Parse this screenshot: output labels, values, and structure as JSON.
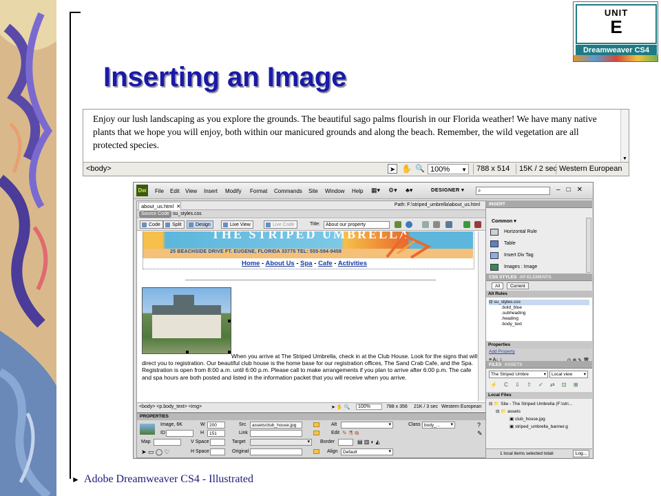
{
  "slide": {
    "title": "Inserting an Image",
    "footer": "Adobe Dreamweaver CS4 - Illustrated",
    "unit_word": "UNIT",
    "unit_letter": "E",
    "unit_product": "Dreamweaver CS4"
  },
  "snippet": {
    "paragraph": "Enjoy our lush landscaping as you explore the grounds. The beautiful sago palms flourish in our Florida weather! We have many native plants that we hope you will enjoy, both within our manicured grounds and along the beach. Remember, the wild vegetation are all protected species.",
    "tag": "<body>",
    "zoom": "100%",
    "dimensions": "788 x 514",
    "download": "15K / 2 sec",
    "encoding": "Western European"
  },
  "dw": {
    "logo": "Dw",
    "menus": [
      "File",
      "Edit",
      "View",
      "Insert",
      "Modify",
      "Format",
      "Commands",
      "Site",
      "Window",
      "Help"
    ],
    "workspace": "DESIGNER",
    "file_tab": "about_us.html",
    "path": "Path: F:\\striped_umbrella\\about_us.html",
    "source_code": "Source Code",
    "css_file": "su_styles.css",
    "btn_code": "Code",
    "btn_split": "Split",
    "btn_design": "Design",
    "btn_liveview": "Live View",
    "btn_livecode": "Live Code",
    "title_label": "Title:",
    "title_value": "About our property",
    "banner_title": "THE STRIPED UMBRELLA",
    "banner_address": "25 BEACHSIDE DRIVE   FT. EUGENE, FLORIDA 33775   TEL: 555-594-9458",
    "nav": {
      "home": "Home",
      "about": "About Us",
      "spa": "Spa",
      "cafe": "Cafe",
      "activities": "Activities",
      "sep": " - "
    },
    "body_text": "When you arrive at The Striped Umbrella, check in at the Club House. Look for the signs that will direct you to registration. Our beautiful club house is the home base for our registration offices, The Sand Crab Cafe, and the Spa. Registration is open from 8:00 a.m. until 6:00 p.m. Please call to make arrangements if you plan to arrive after 6:00 p.m. The cafe and spa hours are both posted and listed in the information packet that you will receive when you arrive.",
    "status": {
      "tags": "<body> <p.body_text> <img>",
      "zoom": "100%",
      "dims": "788 x 356",
      "download": "21K / 3 sec",
      "encoding": "Western European"
    }
  },
  "props": {
    "header": "PROPERTIES",
    "image_label": "Image, 6K",
    "w_label": "W",
    "w_value": "200",
    "h_label": "H",
    "h_value": "151",
    "id_label": "ID",
    "src_label": "Src",
    "src_value": "assets/club_house.jpg",
    "link_label": "Link",
    "alt_label": "Alt",
    "edit_label": "Edit",
    "class_label": "Class",
    "class_value": "body_...",
    "map_label": "Map",
    "vspace_label": "V Space",
    "hspace_label": "H Space",
    "target_label": "Target",
    "original_label": "Original",
    "border_label": "Border",
    "align_label": "Align",
    "align_value": "Default"
  },
  "panels": {
    "insert_header": "INSERT",
    "insert_category": "Common",
    "insert_items": [
      "Horizontal Rule",
      "Table",
      "Insert Div Tag",
      "Images : Image"
    ],
    "css_header": "CSS STYLES",
    "ap_header": "AP ELEMENTS",
    "btn_all": "All",
    "btn_current": "Current",
    "all_rules": "All Rules",
    "css_tree": [
      "su_styles.css",
      ".bold_blue",
      ".subheading",
      ".heading",
      ".body_text"
    ],
    "properties_label": "Properties",
    "add_property": "Add Property",
    "files_header": "FILES",
    "assets_header": "ASSETS",
    "site_select": "The Striped Umbre",
    "view_select": "Local view",
    "local_files": "Local Files",
    "file_tree": [
      "Site - The Striped Umbrella (F:\\stri...",
      "assets",
      "club_house.jpg",
      "striped_umbrella_banner.g"
    ],
    "files_status": "1 local items selected totali",
    "log_button": "Log..."
  }
}
